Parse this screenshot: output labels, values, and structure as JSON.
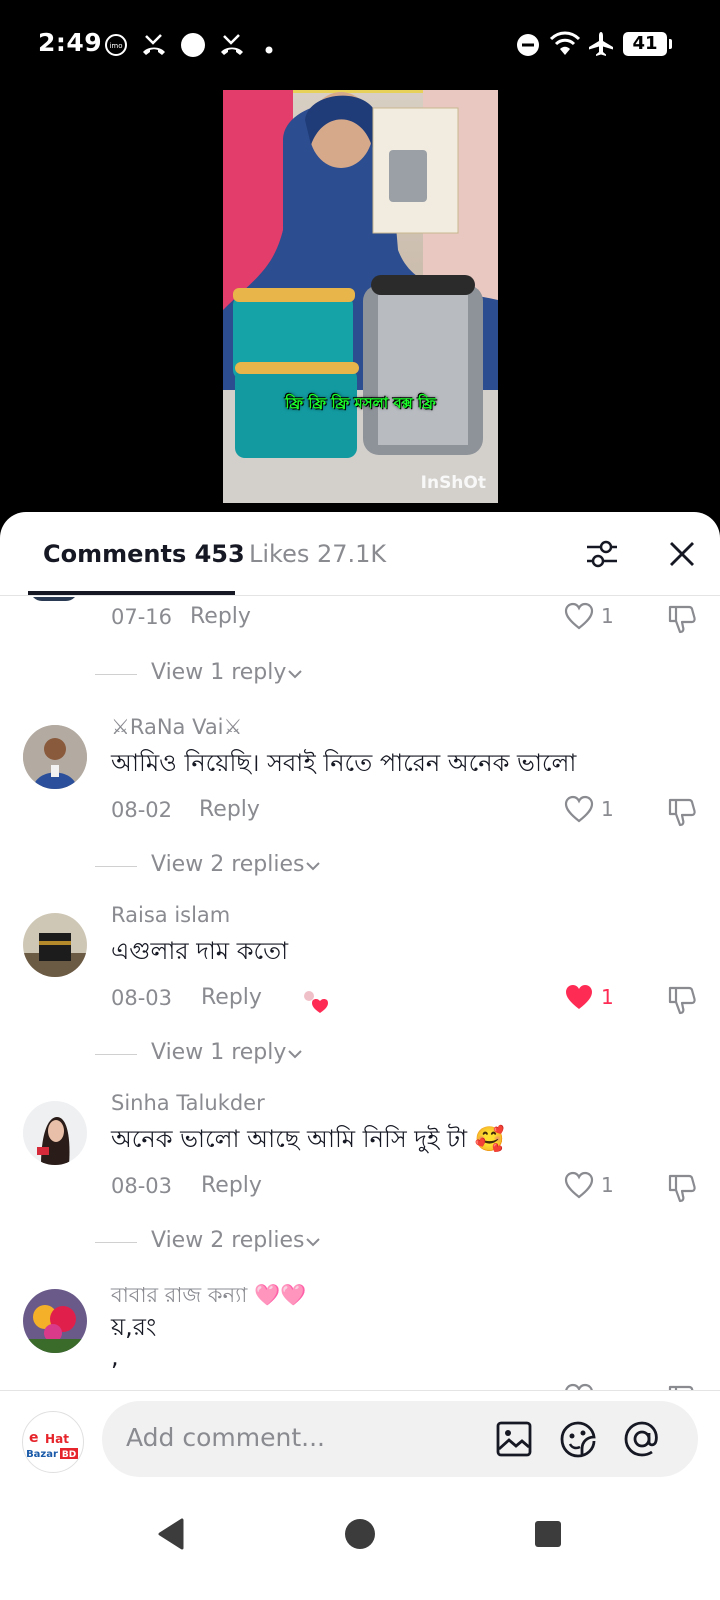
{
  "status_bar": {
    "time": "2:49",
    "battery": "41",
    "icons": [
      "imo-icon",
      "missed-call-icon",
      "circle-icon",
      "missed-call-icon",
      "dot-icon",
      "dnd-icon",
      "wifi-icon",
      "airplane-icon",
      "battery-icon"
    ]
  },
  "video": {
    "caption": "ফ্রি ফ্রি ফ্রি মসলা বক্স ফ্রি",
    "watermark": "InShOt"
  },
  "sheet": {
    "tab_comments": "Comments 453",
    "tab_likes": "Likes 27.1K"
  },
  "comments": [
    {
      "user": "",
      "text": "",
      "date": "07-16",
      "reply_label": "Reply",
      "likes": "1",
      "liked": false,
      "view_replies": "View 1 reply"
    },
    {
      "user": "⚔RaNa Vai⚔",
      "text": "আমিও নিয়েছি। সবাই নিতে পারেন অনেক ভালো",
      "date": "08-02",
      "reply_label": "Reply",
      "likes": "1",
      "liked": false,
      "view_replies": "View 2 replies"
    },
    {
      "user": "Raisa islam",
      "text": "এগুলার দাম কতো",
      "date": "08-03",
      "reply_label": "Reply",
      "likes": "1",
      "liked": true,
      "view_replies": "View 1 reply"
    },
    {
      "user": "Sinha Talukder",
      "text": "অনেক ভালো আছে আমি নিসি দুই টা 🥰",
      "date": "08-03",
      "reply_label": "Reply",
      "likes": "1",
      "liked": false,
      "view_replies": "View 2 replies"
    },
    {
      "user": "বাবার রাজ কন্যা 🩷🩷",
      "text": "য়,রং",
      "text2": ",",
      "date": "",
      "reply_label": "",
      "likes": "",
      "liked": false,
      "view_replies": ""
    }
  ],
  "input": {
    "placeholder": "Add comment...",
    "my_avatar_line1": "Hat",
    "my_avatar_line2": "Bazar",
    "my_avatar_badge": "BD"
  },
  "colors": {
    "accent_red": "#fe2c55",
    "text_primary": "#161823",
    "text_secondary": "#8a8b91",
    "caption_green": "#1aff2a"
  }
}
